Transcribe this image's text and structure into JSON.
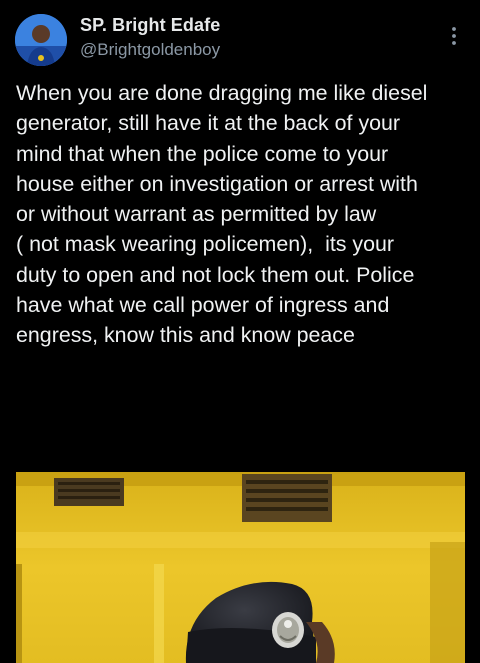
{
  "tweet": {
    "author": {
      "display_name": "SP. Bright Edafe",
      "handle": "@Brightgoldenboy",
      "avatar_icon": "profile-avatar"
    },
    "more_icon": "more-vertical-icon",
    "text_lines": [
      "When you are done dragging me like diesel",
      "generator, still have it at the back of your",
      "mind that when the police come to your",
      "house either on investigation or arrest with",
      "or without warrant as permitted by law",
      "( not mask wearing policemen),  its your",
      "duty to open and not lock them out. Police",
      "have what we call power of ingress and",
      "engress, know this and know peace"
    ],
    "media": {
      "kind": "photo",
      "subject": "police officer in black beret with badge"
    }
  },
  "colors": {
    "background": "#000000",
    "primary_text": "#e7e9ea",
    "secondary_text": "#8b98a5",
    "wall_yellow": "#e8c21e",
    "beret": "#1c1d22"
  }
}
